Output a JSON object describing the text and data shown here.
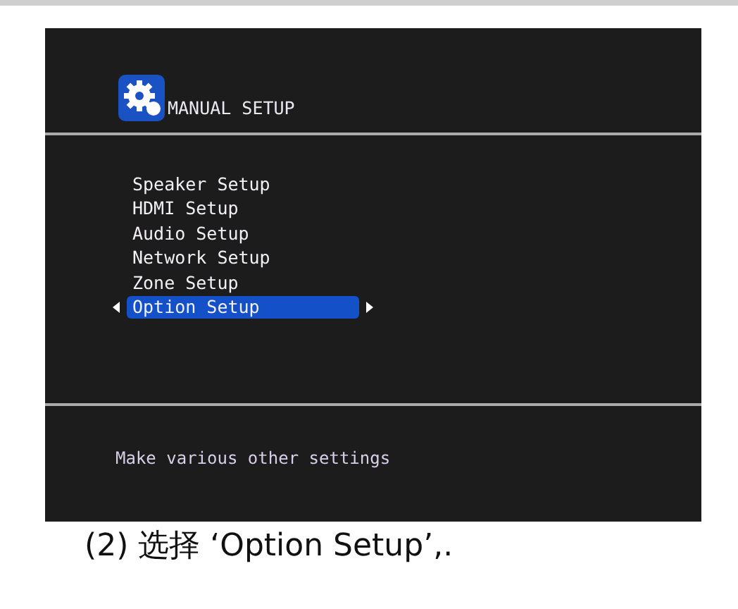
{
  "screen": {
    "title": "MANUAL SETUP",
    "menu": [
      {
        "label": "Speaker Setup",
        "selected": false
      },
      {
        "label": "HDMI Setup",
        "selected": false
      },
      {
        "label": "Audio Setup",
        "selected": false
      },
      {
        "label": "Network Setup",
        "selected": false
      },
      {
        "label": "Zone Setup",
        "selected": false
      },
      {
        "label": "Option Setup",
        "selected": true
      }
    ],
    "help": "Make various other settings"
  },
  "caption": "(2) 选择 ‘Option Setup’,."
}
